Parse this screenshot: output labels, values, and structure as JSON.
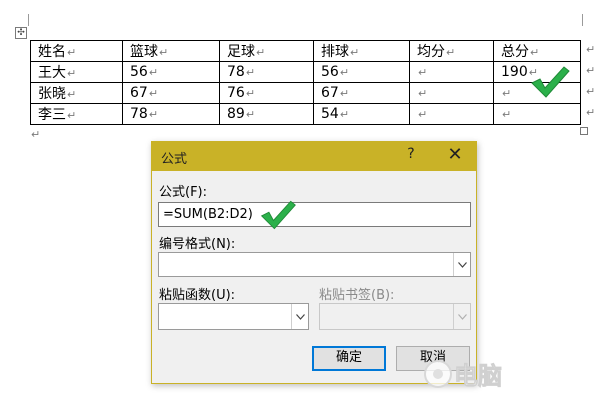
{
  "document": {
    "table": {
      "rows": [
        [
          "姓名",
          "篮球",
          "足球",
          "排球",
          "均分",
          "总分"
        ],
        [
          "王大",
          "56",
          "78",
          "56",
          "",
          "190"
        ],
        [
          "张晓",
          "67",
          "76",
          "67",
          "",
          ""
        ],
        [
          "李三",
          "78",
          "89",
          "54",
          "",
          ""
        ]
      ]
    },
    "paragraph_mark": "↵",
    "move_handle_icon": "move-cross",
    "checkmark_color": "#2bb04a"
  },
  "dialog": {
    "title": "公式",
    "help": "?",
    "close": "✕",
    "formula_label": "公式(F):",
    "formula_value": "=SUM(B2:D2)",
    "number_format_label": "编号格式(N):",
    "number_format_value": "",
    "paste_function_label": "粘贴函数(U):",
    "paste_function_value": "",
    "paste_bookmark_label": "粘贴书签(B):",
    "paste_bookmark_value": "",
    "ok_label": "确定",
    "cancel_label": "取消",
    "title_bar_color": "#c9b227"
  },
  "watermark": {
    "text": "电脑"
  }
}
